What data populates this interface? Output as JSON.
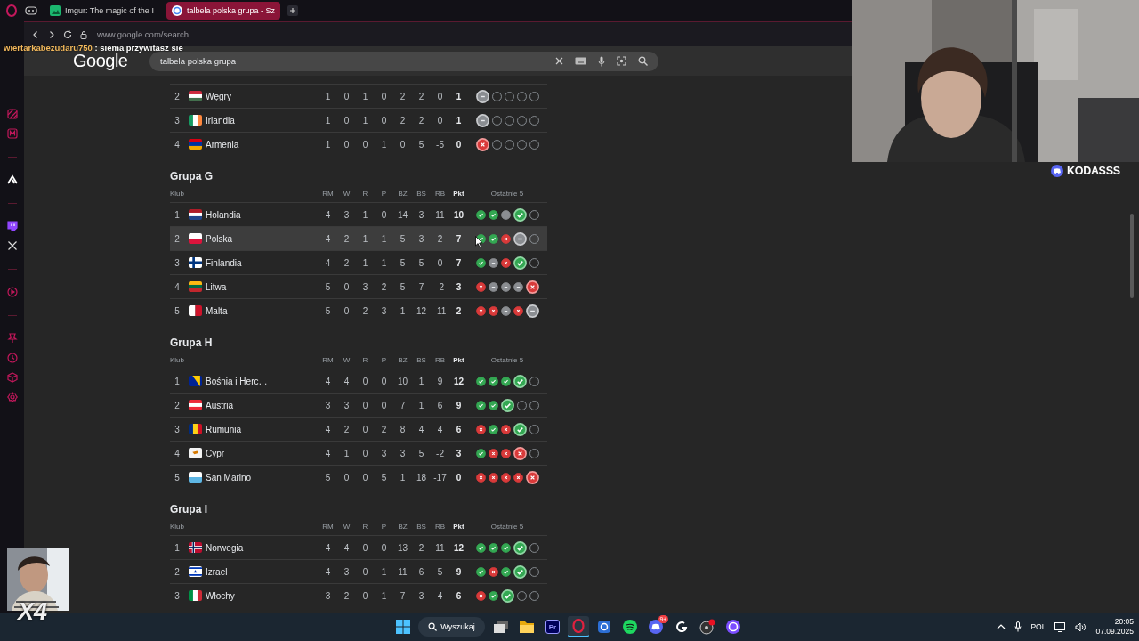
{
  "browser": {
    "tabs": [
      {
        "title": "Imgur: The magic of the I",
        "selected": false
      },
      {
        "title": "talbela polska grupa - Sz",
        "selected": true
      }
    ],
    "url": "www.google.com/search"
  },
  "chat": {
    "user": "wiertarkabezudaru750",
    "message": ": siema przywitasz sie"
  },
  "google": {
    "logo": "Google",
    "query": "talbela polska grupa"
  },
  "groups": [
    {
      "rows": [
        {
          "rank": "2",
          "name": "Węgry",
          "stats": [
            "1",
            "0",
            "1",
            "0",
            "2",
            "2",
            "0",
            "1"
          ],
          "selected": false,
          "form": [
            {
              "kind": "draw",
              "latest": true
            },
            {
              "kind": "none",
              "latest": false
            },
            {
              "kind": "none",
              "latest": false
            },
            {
              "kind": "none",
              "latest": false
            },
            {
              "kind": "none",
              "latest": false
            }
          ]
        },
        {
          "rank": "3",
          "name": "Irlandia",
          "stats": [
            "1",
            "0",
            "1",
            "0",
            "2",
            "2",
            "0",
            "1"
          ],
          "selected": false,
          "form": [
            {
              "kind": "draw",
              "latest": true
            },
            {
              "kind": "none",
              "latest": false
            },
            {
              "kind": "none",
              "latest": false
            },
            {
              "kind": "none",
              "latest": false
            },
            {
              "kind": "none",
              "latest": false
            }
          ]
        },
        {
          "rank": "4",
          "name": "Armenia",
          "stats": [
            "1",
            "0",
            "0",
            "1",
            "0",
            "5",
            "-5",
            "0"
          ],
          "selected": false,
          "form": [
            {
              "kind": "loss",
              "latest": true
            },
            {
              "kind": "none",
              "latest": false
            },
            {
              "kind": "none",
              "latest": false
            },
            {
              "kind": "none",
              "latest": false
            },
            {
              "kind": "none",
              "latest": false
            }
          ]
        }
      ]
    },
    {
      "title": "Grupa G",
      "header": {
        "club": "Klub",
        "stats": [
          "RM",
          "W",
          "R",
          "P",
          "BZ",
          "BS",
          "RB",
          "Pkt"
        ],
        "form": "Ostatnie 5"
      },
      "rows": [
        {
          "rank": "1",
          "name": "Holandia",
          "stats": [
            "4",
            "3",
            "1",
            "0",
            "14",
            "3",
            "11",
            "10"
          ],
          "selected": false,
          "form": [
            {
              "kind": "win",
              "latest": false
            },
            {
              "kind": "win",
              "latest": false
            },
            {
              "kind": "draw",
              "latest": false
            },
            {
              "kind": "win",
              "latest": true
            },
            {
              "kind": "none",
              "latest": false
            }
          ]
        },
        {
          "rank": "2",
          "name": "Polska",
          "stats": [
            "4",
            "2",
            "1",
            "1",
            "5",
            "3",
            "2",
            "7"
          ],
          "selected": true,
          "form": [
            {
              "kind": "win",
              "latest": false
            },
            {
              "kind": "win",
              "latest": false
            },
            {
              "kind": "loss",
              "latest": false
            },
            {
              "kind": "draw",
              "latest": true
            },
            {
              "kind": "none",
              "latest": false
            }
          ]
        },
        {
          "rank": "3",
          "name": "Finlandia",
          "stats": [
            "4",
            "2",
            "1",
            "1",
            "5",
            "5",
            "0",
            "7"
          ],
          "selected": false,
          "form": [
            {
              "kind": "win",
              "latest": false
            },
            {
              "kind": "draw",
              "latest": false
            },
            {
              "kind": "loss",
              "latest": false
            },
            {
              "kind": "win",
              "latest": true
            },
            {
              "kind": "none",
              "latest": false
            }
          ]
        },
        {
          "rank": "4",
          "name": "Litwa",
          "stats": [
            "5",
            "0",
            "3",
            "2",
            "5",
            "7",
            "-2",
            "3"
          ],
          "selected": false,
          "form": [
            {
              "kind": "loss",
              "latest": false
            },
            {
              "kind": "draw",
              "latest": false
            },
            {
              "kind": "draw",
              "latest": false
            },
            {
              "kind": "draw",
              "latest": false
            },
            {
              "kind": "loss",
              "latest": true
            }
          ]
        },
        {
          "rank": "5",
          "name": "Malta",
          "stats": [
            "5",
            "0",
            "2",
            "3",
            "1",
            "12",
            "-11",
            "2"
          ],
          "selected": false,
          "form": [
            {
              "kind": "loss",
              "latest": false
            },
            {
              "kind": "loss",
              "latest": false
            },
            {
              "kind": "draw",
              "latest": false
            },
            {
              "kind": "loss",
              "latest": false
            },
            {
              "kind": "draw",
              "latest": true
            }
          ]
        }
      ]
    },
    {
      "title": "Grupa H",
      "header": {
        "club": "Klub",
        "stats": [
          "RM",
          "W",
          "R",
          "P",
          "BZ",
          "BS",
          "RB",
          "Pkt"
        ],
        "form": "Ostatnie 5"
      },
      "rows": [
        {
          "rank": "1",
          "name": "Bośnia i Herc…",
          "stats": [
            "4",
            "4",
            "0",
            "0",
            "10",
            "1",
            "9",
            "12"
          ],
          "selected": false,
          "form": [
            {
              "kind": "win",
              "latest": false
            },
            {
              "kind": "win",
              "latest": false
            },
            {
              "kind": "win",
              "latest": false
            },
            {
              "kind": "win",
              "latest": true
            },
            {
              "kind": "none",
              "latest": false
            }
          ]
        },
        {
          "rank": "2",
          "name": "Austria",
          "stats": [
            "3",
            "3",
            "0",
            "0",
            "7",
            "1",
            "6",
            "9"
          ],
          "selected": false,
          "form": [
            {
              "kind": "win",
              "latest": false
            },
            {
              "kind": "win",
              "latest": false
            },
            {
              "kind": "win",
              "latest": true
            },
            {
              "kind": "none",
              "latest": false
            },
            {
              "kind": "none",
              "latest": false
            }
          ]
        },
        {
          "rank": "3",
          "name": "Rumunia",
          "stats": [
            "4",
            "2",
            "0",
            "2",
            "8",
            "4",
            "4",
            "6"
          ],
          "selected": false,
          "form": [
            {
              "kind": "loss",
              "latest": false
            },
            {
              "kind": "win",
              "latest": false
            },
            {
              "kind": "loss",
              "latest": false
            },
            {
              "kind": "win",
              "latest": true
            },
            {
              "kind": "none",
              "latest": false
            }
          ]
        },
        {
          "rank": "4",
          "name": "Cypr",
          "stats": [
            "4",
            "1",
            "0",
            "3",
            "3",
            "5",
            "-2",
            "3"
          ],
          "selected": false,
          "form": [
            {
              "kind": "win",
              "latest": false
            },
            {
              "kind": "loss",
              "latest": false
            },
            {
              "kind": "loss",
              "latest": false
            },
            {
              "kind": "loss",
              "latest": true
            },
            {
              "kind": "none",
              "latest": false
            }
          ]
        },
        {
          "rank": "5",
          "name": "San Marino",
          "stats": [
            "5",
            "0",
            "0",
            "5",
            "1",
            "18",
            "-17",
            "0"
          ],
          "selected": false,
          "form": [
            {
              "kind": "loss",
              "latest": false
            },
            {
              "kind": "loss",
              "latest": false
            },
            {
              "kind": "loss",
              "latest": false
            },
            {
              "kind": "loss",
              "latest": false
            },
            {
              "kind": "loss",
              "latest": true
            }
          ]
        }
      ]
    },
    {
      "title": "Grupa I",
      "header": {
        "club": "Klub",
        "stats": [
          "RM",
          "W",
          "R",
          "P",
          "BZ",
          "BS",
          "RB",
          "Pkt"
        ],
        "form": "Ostatnie 5"
      },
      "rows": [
        {
          "rank": "1",
          "name": "Norwegia",
          "stats": [
            "4",
            "4",
            "0",
            "0",
            "13",
            "2",
            "11",
            "12"
          ],
          "selected": false,
          "form": [
            {
              "kind": "win",
              "latest": false
            },
            {
              "kind": "win",
              "latest": false
            },
            {
              "kind": "win",
              "latest": false
            },
            {
              "kind": "win",
              "latest": true
            },
            {
              "kind": "none",
              "latest": false
            }
          ]
        },
        {
          "rank": "2",
          "name": "Izrael",
          "stats": [
            "4",
            "3",
            "0",
            "1",
            "11",
            "6",
            "5",
            "9"
          ],
          "selected": false,
          "form": [
            {
              "kind": "win",
              "latest": false
            },
            {
              "kind": "loss",
              "latest": false
            },
            {
              "kind": "win",
              "latest": false
            },
            {
              "kind": "win",
              "latest": true
            },
            {
              "kind": "none",
              "latest": false
            }
          ]
        },
        {
          "rank": "3",
          "name": "Włochy",
          "stats": [
            "3",
            "2",
            "0",
            "1",
            "7",
            "3",
            "4",
            "6"
          ],
          "selected": false,
          "form": [
            {
              "kind": "loss",
              "latest": false
            },
            {
              "kind": "win",
              "latest": false
            },
            {
              "kind": "win",
              "latest": true
            },
            {
              "kind": "none",
              "latest": false
            },
            {
              "kind": "none",
              "latest": false
            }
          ]
        }
      ]
    }
  ],
  "stream": {
    "channel": "KODASSS",
    "multiplier": "X4"
  },
  "taskbar": {
    "search": "Wyszukaj",
    "premiere": "Pr",
    "discord_badge": "9+",
    "language": "POL",
    "time": "20:05",
    "date": "07.09.2025"
  }
}
